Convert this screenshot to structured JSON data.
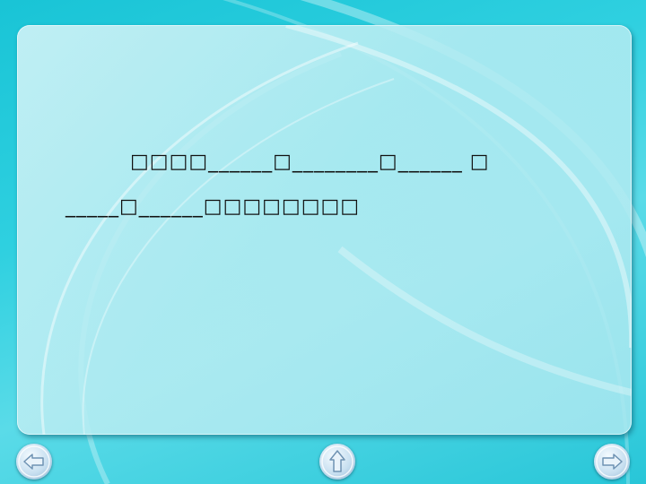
{
  "slide": {
    "line1": "□□□□______□________□______ □",
    "line2": "_____□______□□□□□□□□"
  },
  "navigation": {
    "prev_icon": "left-arrow-icon",
    "home_icon": "up-arrow-icon",
    "next_icon": "right-arrow-icon"
  },
  "colors": {
    "background": "#2fd0e0",
    "panel": "#c4eff4",
    "button": "#c7dff0"
  }
}
